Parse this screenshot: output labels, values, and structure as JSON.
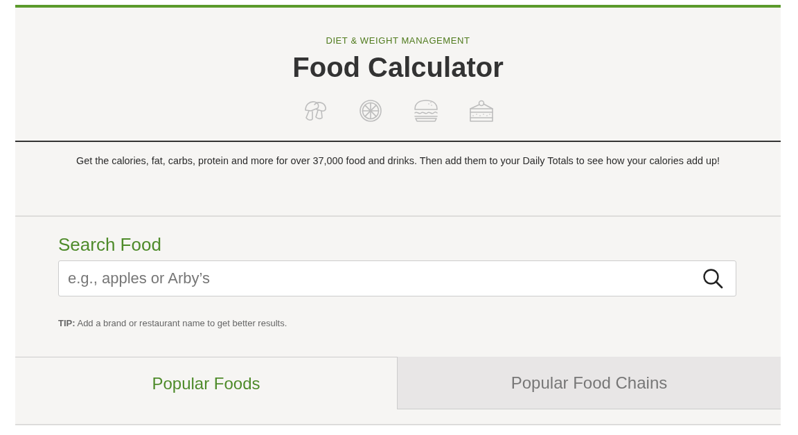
{
  "header": {
    "eyebrow": "DIET & WEIGHT MANAGEMENT",
    "title": "Food Calculator",
    "icons": [
      {
        "kind": "mushroom"
      },
      {
        "kind": "citrus"
      },
      {
        "kind": "burger"
      },
      {
        "kind": "cake"
      }
    ]
  },
  "intro": "Get the calories, fat, carbs, protein and more for over 37,000 food and drinks. Then add them to your Daily Totals to see how your calories add up!",
  "search": {
    "label": "Search Food",
    "placeholder": "e.g., apples or Arby’s",
    "tip": "**TIP:** Add a brand or restaurant name to get better results."
  },
  "tabs": [
    {
      "label": "Popular Foods",
      "selected": true
    },
    {
      "label": "Popular Food Chains",
      "selected": false
    }
  ]
}
